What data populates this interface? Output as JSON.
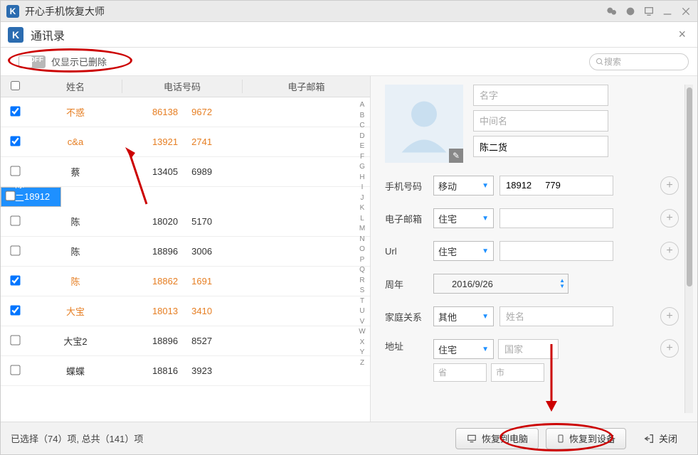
{
  "app": {
    "logo": "K",
    "title": "开心手机恢复大师",
    "sub_logo": "K",
    "sub_title": "通讯录"
  },
  "toolbar": {
    "toggle_off": "OFF",
    "toggle_label": "仅显示已删除",
    "search_placeholder": "搜索"
  },
  "table": {
    "headers": {
      "name": "姓名",
      "phone": "电话号码",
      "email": "电子邮箱"
    },
    "rows": [
      {
        "checked": true,
        "deleted": true,
        "selected": false,
        "name": "不惑",
        "phone": "86138⠀⠀9672"
      },
      {
        "checked": true,
        "deleted": true,
        "selected": false,
        "name": "c&a",
        "phone": "13921⠀⠀2741"
      },
      {
        "checked": false,
        "deleted": false,
        "selected": false,
        "name": "蔡",
        "phone": "13405⠀⠀6989"
      },
      {
        "checked": false,
        "deleted": false,
        "selected": true,
        "name": "陈二货",
        "phone": "18912⠀⠀779"
      },
      {
        "checked": false,
        "deleted": false,
        "selected": false,
        "name": "陈",
        "phone": "18020⠀⠀5170"
      },
      {
        "checked": false,
        "deleted": false,
        "selected": false,
        "name": "陈",
        "phone": "18896⠀⠀3006"
      },
      {
        "checked": true,
        "deleted": true,
        "selected": false,
        "name": "陈",
        "phone": "18862⠀⠀1691"
      },
      {
        "checked": true,
        "deleted": true,
        "selected": false,
        "name": "大宝",
        "phone": "18013⠀⠀3410"
      },
      {
        "checked": false,
        "deleted": false,
        "selected": false,
        "name": "大宝2",
        "phone": "18896⠀⠀8527"
      },
      {
        "checked": false,
        "deleted": false,
        "selected": false,
        "name": "蝶蝶",
        "phone": "18816⠀⠀3923"
      }
    ]
  },
  "alpha": [
    "A",
    "B",
    "C",
    "D",
    "E",
    "F",
    "G",
    "H",
    "I",
    "J",
    "K",
    "L",
    "M",
    "N",
    "O",
    "P",
    "Q",
    "R",
    "S",
    "T",
    "U",
    "V",
    "W",
    "X",
    "Y",
    "Z"
  ],
  "detail": {
    "first_name_ph": "名字",
    "middle_name_ph": "中间名",
    "last_name": "陈二货",
    "fields": {
      "phone_label": "手机号码",
      "phone_type": "移动",
      "phone_value": "18912⠀⠀779",
      "email_label": "电子邮箱",
      "email_type": "住宅",
      "url_label": "Url",
      "url_type": "住宅",
      "anniv_label": "周年",
      "anniv_value": "2016/9/26",
      "family_label": "家庭关系",
      "family_type": "其他",
      "family_name_ph": "姓名",
      "addr_label": "地址",
      "addr_type": "住宅",
      "country_ph": "国家",
      "province_ph": "省",
      "city_ph": "市"
    }
  },
  "footer": {
    "status": "已选择（74）项, 总共（141）项",
    "btn_pc": "恢复到电脑",
    "btn_device": "恢复到设备",
    "btn_close": "关闭"
  }
}
